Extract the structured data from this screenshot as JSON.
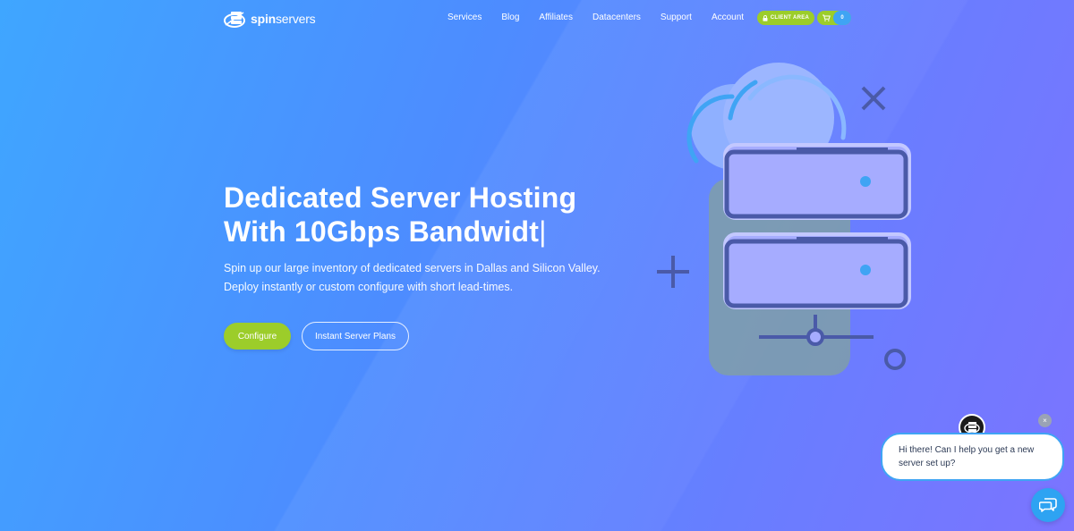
{
  "header": {
    "logo_bold": "spin",
    "logo_light": "servers",
    "nav": [
      {
        "name": "nav-services",
        "label": "Services"
      },
      {
        "name": "nav-blog",
        "label": "Blog"
      },
      {
        "name": "nav-affiliates",
        "label": "Affiliates"
      },
      {
        "name": "nav-datacenters",
        "label": "Datacenters"
      },
      {
        "name": "nav-support",
        "label": "Support"
      },
      {
        "name": "nav-account",
        "label": "Account"
      }
    ],
    "client_area_label": "CLIENT AREA",
    "cart_count": "0"
  },
  "hero": {
    "title_line1": "Dedicated Server Hosting",
    "title_line2": "With 10Gbps Bandwidt",
    "cursor": "|",
    "subtitle_line1": "Spin up our large inventory of dedicated servers in Dallas and Silicon Valley.",
    "subtitle_line2": "Deploy instantly or custom configure with short lead-times.",
    "configure_label": "Configure",
    "plans_label": "Instant Server Plans"
  },
  "chat": {
    "message_line1": "Hi there! Can I help you get a new",
    "message_line2": "server set up?",
    "close_symbol": "×"
  },
  "colors": {
    "accent_green": "#9ccd2a",
    "accent_blue": "#3fa4f4",
    "illustration_stroke": "#4a5aa8"
  }
}
